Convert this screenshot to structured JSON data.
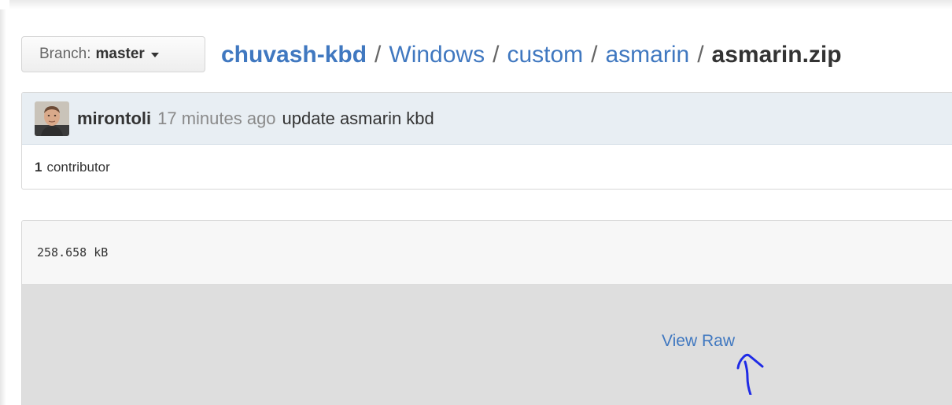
{
  "branch": {
    "prefix": "Branch:",
    "name": "master"
  },
  "breadcrumb": {
    "repo": "chuvash-kbd",
    "separator": "/",
    "path": [
      "Windows",
      "custom",
      "asmarin"
    ],
    "file": "asmarin.zip"
  },
  "commit": {
    "author": "mirontoli",
    "time": "17 minutes ago",
    "message": "update asmarin kbd"
  },
  "contributors": {
    "count": "1",
    "label": "contributor"
  },
  "file": {
    "size": "258.658 kB",
    "view_raw_label": "View Raw"
  },
  "colors": {
    "link": "#4078c0",
    "annotation": "#1f2be6"
  }
}
